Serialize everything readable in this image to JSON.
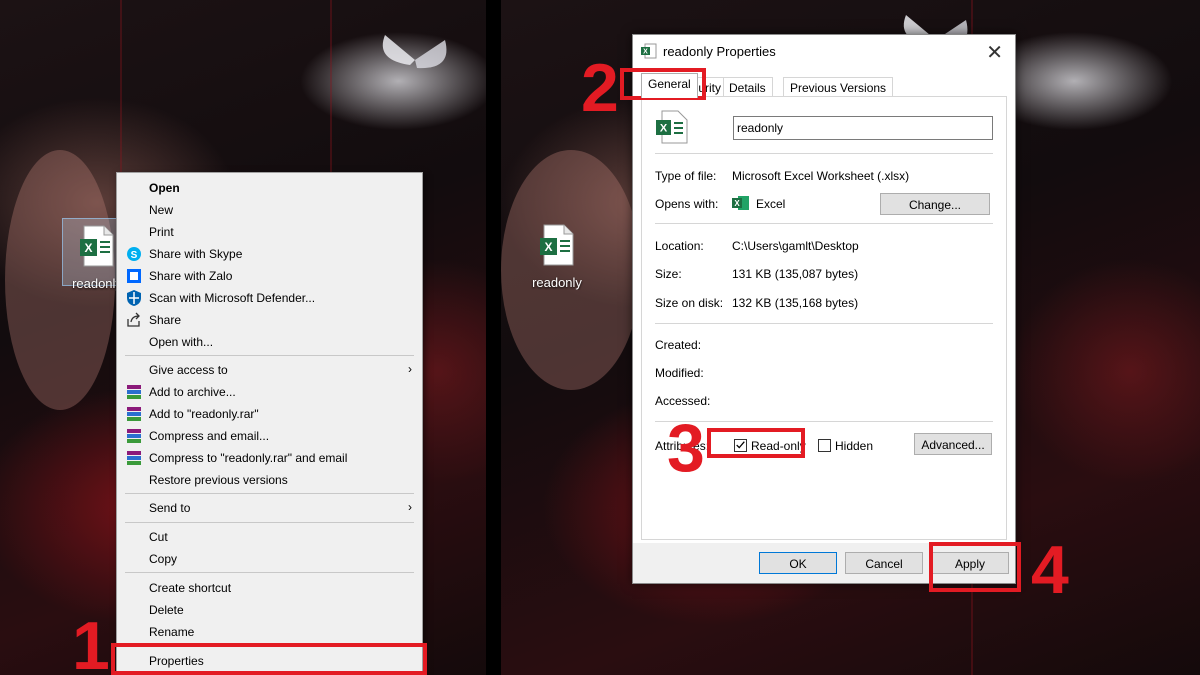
{
  "desktop": {
    "file_label": "readonly"
  },
  "context_menu": {
    "open": "Open",
    "new": "New",
    "print": "Print",
    "share_skype": "Share with Skype",
    "share_zalo": "Share with Zalo",
    "scan_defender": "Scan with Microsoft Defender...",
    "share": "Share",
    "open_with": "Open with...",
    "give_access": "Give access to",
    "add_archive": "Add to archive...",
    "add_rar": "Add to \"readonly.rar\"",
    "compress_email": "Compress and email...",
    "compress_rar_email": "Compress to \"readonly.rar\" and email",
    "restore": "Restore previous versions",
    "send_to": "Send to",
    "cut": "Cut",
    "copy": "Copy",
    "create_shortcut": "Create shortcut",
    "delete": "Delete",
    "rename": "Rename",
    "properties": "Properties"
  },
  "annotations": {
    "step1": "1",
    "step2": "2",
    "step3": "3",
    "step4": "4"
  },
  "dialog": {
    "title": "readonly Properties",
    "tabs": {
      "general": "General",
      "security": "Security",
      "details": "Details",
      "previous": "Previous Versions"
    },
    "file_name": "readonly",
    "type_label": "Type of file:",
    "type_value": "Microsoft Excel Worksheet (.xlsx)",
    "opens_label": "Opens with:",
    "opens_value": "Excel",
    "change_button": "Change...",
    "location_label": "Location:",
    "location_value": "C:\\Users\\gamlt\\Desktop",
    "size_label": "Size:",
    "size_value": "131 KB (135,087 bytes)",
    "size_disk_label": "Size on disk:",
    "size_disk_value": "132 KB (135,168 bytes)",
    "created_label": "Created:",
    "modified_label": "Modified:",
    "accessed_label": "Accessed:",
    "attributes_label": "Attributes:",
    "readonly_label": "Read-only",
    "readonly_checked": true,
    "hidden_label": "Hidden",
    "hidden_checked": false,
    "advanced_button": "Advanced...",
    "ok_button": "OK",
    "cancel_button": "Cancel",
    "apply_button": "Apply"
  },
  "colors": {
    "annotation": "#e31b23",
    "excel_green": "#1d6f42",
    "menu_bg": "#f0f0f0"
  }
}
